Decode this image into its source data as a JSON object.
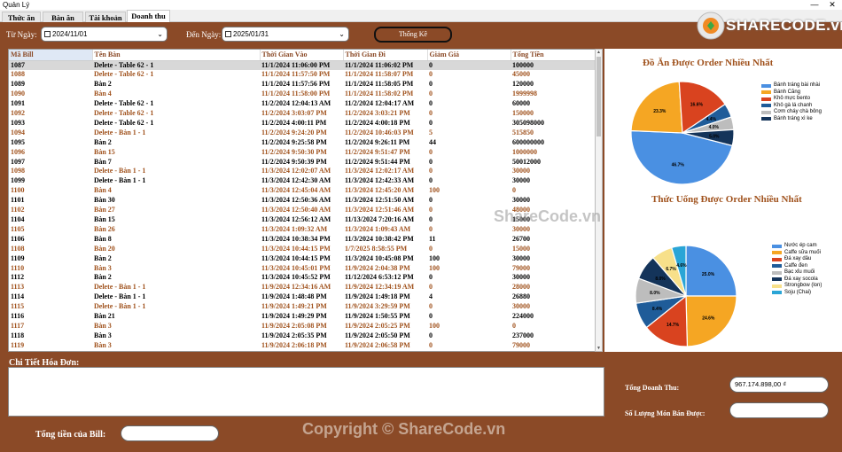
{
  "window": {
    "title": "Quản Lý",
    "minimize": "—",
    "close": "✕"
  },
  "tabs": [
    {
      "label": "Thức ăn"
    },
    {
      "label": "Bàn ăn"
    },
    {
      "label": "Tài khoản"
    },
    {
      "label": "Doanh thu"
    }
  ],
  "filters": {
    "from_label": "Từ Ngày:",
    "from_value": "2024/11/01",
    "to_label": "Đến Ngày:",
    "to_value": "2025/01/31",
    "stats_button": "Thống Kê"
  },
  "table": {
    "columns": [
      "Mã Bill",
      "Tên Bàn",
      "Thời Gian Vào",
      "Thời Gian Đi",
      "Giảm Giá",
      "Tổng Tiền"
    ],
    "rows": [
      [
        "1087",
        "Delete - Table 62 - 1",
        "11/1/2024 11:06:00 PM",
        "11/1/2024 11:06:02 PM",
        "0",
        "100000"
      ],
      [
        "1088",
        "Delete - Table 62 - 1",
        "11/1/2024 11:57:50 PM",
        "11/1/2024 11:58:07 PM",
        "0",
        "45000"
      ],
      [
        "1089",
        "Bàn 2",
        "11/1/2024 11:57:56 PM",
        "11/1/2024 11:58:05 PM",
        "0",
        "120000"
      ],
      [
        "1090",
        "Bàn 4",
        "11/1/2024 11:58:00 PM",
        "11/1/2024 11:58:02 PM",
        "0",
        "1999998"
      ],
      [
        "1091",
        "Delete - Table 62 - 1",
        "11/2/2024 12:04:13 AM",
        "11/2/2024 12:04:17 AM",
        "0",
        "60000"
      ],
      [
        "1092",
        "Delete - Table 62 - 1",
        "11/2/2024 3:03:07 PM",
        "11/2/2024 3:03:21 PM",
        "0",
        "150000"
      ],
      [
        "1093",
        "Delete - Table 62 - 1",
        "11/2/2024 4:00:11 PM",
        "11/2/2024 4:00:18 PM",
        "0",
        "305098000"
      ],
      [
        "1094",
        "Delete - Bàn 1 - 1",
        "11/2/2024 9:24:20 PM",
        "11/2/2024 10:46:03 PM",
        "5",
        "515850"
      ],
      [
        "1095",
        "Bàn 2",
        "11/2/2024 9:25:58 PM",
        "11/2/2024 9:26:11 PM",
        "44",
        "600000000"
      ],
      [
        "1096",
        "Bàn 15",
        "11/2/2024 9:50:30 PM",
        "11/2/2024 9:51:47 PM",
        "0",
        "1000000"
      ],
      [
        "1097",
        "Bàn 7",
        "11/2/2024 9:50:39 PM",
        "11/2/2024 9:51:44 PM",
        "0",
        "50012000"
      ],
      [
        "1098",
        "Delete - Bàn 1 - 1",
        "11/3/2024 12:02:07 AM",
        "11/3/2024 12:02:17 AM",
        "0",
        "30000"
      ],
      [
        "1099",
        "Delete - Bàn 1 - 1",
        "11/3/2024 12:42:30 AM",
        "11/3/2024 12:42:33 AM",
        "0",
        "30000"
      ],
      [
        "1100",
        "Bàn 4",
        "11/3/2024 12:45:04 AM",
        "11/3/2024 12:45:20 AM",
        "100",
        "0"
      ],
      [
        "1101",
        "Bàn 30",
        "11/3/2024 12:50:36 AM",
        "11/3/2024 12:51:50 AM",
        "0",
        "30000"
      ],
      [
        "1102",
        "Bàn 27",
        "11/3/2024 12:50:40 AM",
        "11/3/2024 12:51:46 AM",
        "0",
        "48000"
      ],
      [
        "1104",
        "Bàn 15",
        "11/3/2024 12:56:12 AM",
        "11/13/2024 7:20:16 AM",
        "0",
        "15000"
      ],
      [
        "1105",
        "Bàn 26",
        "11/3/2024 1:09:32 AM",
        "11/3/2024 1:09:43 AM",
        "0",
        "30000"
      ],
      [
        "1106",
        "Bàn 8",
        "11/3/2024 10:38:34 PM",
        "11/3/2024 10:38:42 PM",
        "11",
        "26700"
      ],
      [
        "1108",
        "Bàn 20",
        "11/3/2024 10:44:15 PM",
        "1/7/2025 8:58:55 PM",
        "0",
        "15000"
      ],
      [
        "1109",
        "Bàn 2",
        "11/3/2024 10:44:15 PM",
        "11/3/2024 10:45:08 PM",
        "100",
        "30000"
      ],
      [
        "1110",
        "Bàn 3",
        "11/3/2024 10:45:01 PM",
        "11/9/2024 2:04:38 PM",
        "100",
        "79000"
      ],
      [
        "1112",
        "Bàn 2",
        "11/3/2024 10:45:52 PM",
        "11/12/2024 6:53:12 PM",
        "0",
        "30000"
      ],
      [
        "1113",
        "Delete - Bàn 1 - 1",
        "11/9/2024 12:34:16 AM",
        "11/9/2024 12:34:19 AM",
        "0",
        "28000"
      ],
      [
        "1114",
        "Delete - Bàn 1 - 1",
        "11/9/2024 1:48:48 PM",
        "11/9/2024 1:49:18 PM",
        "4",
        "26880"
      ],
      [
        "1115",
        "Delete - Bàn 1 - 1",
        "11/9/2024 1:49:21 PM",
        "11/9/2024 3:29:59 PM",
        "0",
        "30000"
      ],
      [
        "1116",
        "Bàn 21",
        "11/9/2024 1:49:29 PM",
        "11/9/2024 1:50:55 PM",
        "0",
        "224000"
      ],
      [
        "1117",
        "Bàn 3",
        "11/9/2024 2:05:08 PM",
        "11/9/2024 2:05:25 PM",
        "100",
        "0"
      ],
      [
        "1118",
        "Bàn 3",
        "11/9/2024 2:05:35 PM",
        "11/9/2024 2:05:50 PM",
        "0",
        "237000"
      ],
      [
        "1119",
        "Bàn 3",
        "11/9/2024 2:06:18 PM",
        "11/9/2024 2:06:58 PM",
        "0",
        "79000"
      ]
    ]
  },
  "chart_data": [
    {
      "type": "pie",
      "title": "Đồ Ăn Được Order Nhiều Nhất",
      "legend_position": "right",
      "categories": [
        "Bánh tráng bài nhài",
        "Bánh Căng",
        "Khô mực bento",
        "Khô gà lá chanh",
        "Cơm cháy chà bông",
        "Bánh tráng xì ke"
      ],
      "values": [
        46.7,
        23.3,
        16.6,
        4.4,
        4.0,
        5.0
      ],
      "labels": [
        "46.7%",
        "23.3%",
        "16.6%",
        "4.4%",
        "4.0%",
        "5.0%"
      ],
      "colors": [
        "#4A90E2",
        "#F5A623",
        "#D9431F",
        "#1F5C99",
        "#BDBDBD",
        "#14345A"
      ]
    },
    {
      "type": "pie",
      "title": "Thức Uống Được Order Nhiều Nhất",
      "legend_position": "right",
      "categories": [
        "Nước ép cam",
        "Caffe sữa muối",
        "Đá xay dâu",
        "Caffe đen",
        "Bạc xỉu muối",
        "Đá xay socola",
        "Strongbow (lon)",
        "Soju (Chai)"
      ],
      "values": [
        25.0,
        24.6,
        14.7,
        8.4,
        8.0,
        8.0,
        6.7,
        4.6
      ],
      "labels": [
        "25.0%",
        "24.6%",
        "14.7%",
        "8.4%",
        "8.0%",
        "8.0%",
        "6.7%",
        "4.6%"
      ],
      "colors": [
        "#4A90E2",
        "#F5A623",
        "#D9431F",
        "#1F5C99",
        "#BDBDBD",
        "#14345A",
        "#F7E08A",
        "#2AA5D6"
      ]
    }
  ],
  "detail": {
    "label": "Chi Tiết Hóa Đơn:"
  },
  "summary": {
    "revenue_label": "Tổng Doanh Thu:",
    "revenue_value": "967.174.898,00 ₫",
    "items_label": "Số Lượng Món Bán Được:",
    "items_value": "",
    "bill_total_label": "Tổng tiền của Bill:",
    "bill_total_value": ""
  },
  "watermarks": {
    "logo_text": "SHARECODE.vn",
    "center": "ShareCode.vn",
    "bottom": "Copyright © ShareCode.vn"
  },
  "colors": {
    "accent": "#8B4A27",
    "alt_text": "#A0521D"
  }
}
